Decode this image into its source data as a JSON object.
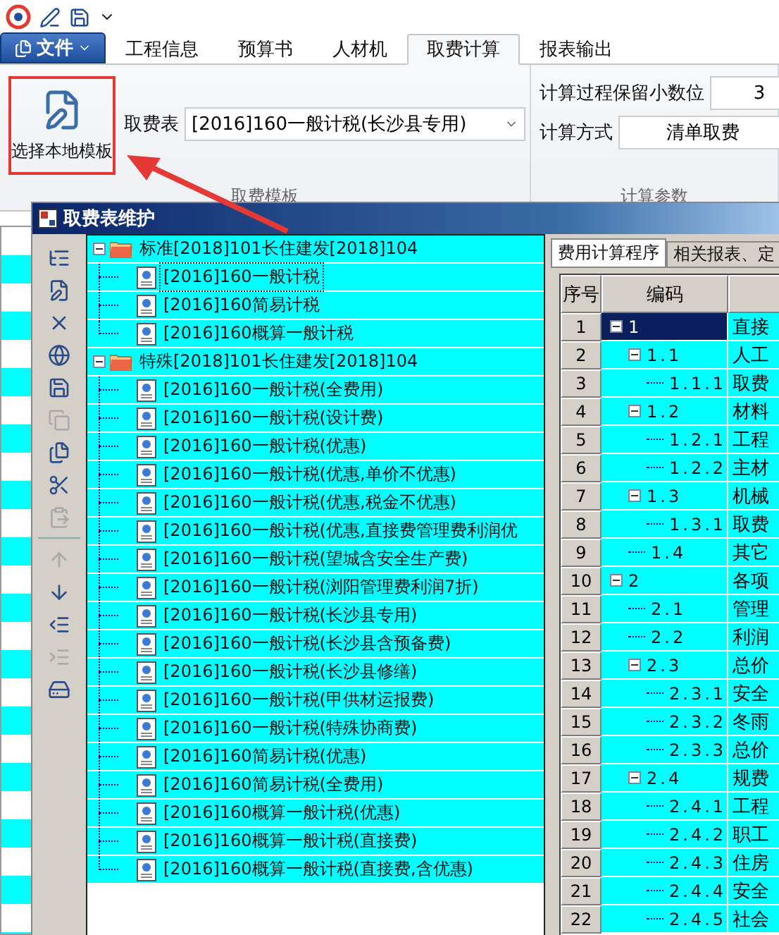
{
  "menu_button": {
    "label": "文件"
  },
  "tabs": [
    {
      "label": "工程信息",
      "selected": false
    },
    {
      "label": "预算书",
      "selected": false
    },
    {
      "label": "人材机",
      "selected": false
    },
    {
      "label": "取费计算",
      "selected": true
    },
    {
      "label": "报表输出",
      "selected": false
    }
  ],
  "ribbon": {
    "template_button": {
      "label": "选择本地模板",
      "highlighted": true
    },
    "fee_table": {
      "label": "取费表",
      "value": "[2016]160一般计税(长沙县专用)"
    },
    "group_1": "取费模板",
    "decimals": {
      "label": "计算过程保留小数位",
      "value": "3"
    },
    "method": {
      "label": "计算方式",
      "value": "清单取费"
    },
    "group_2": "计算参数"
  },
  "callout_arrow": true,
  "dialog": {
    "title": "取费表维护",
    "toolbar": [
      {
        "disabled": false
      },
      {
        "disabled": false
      },
      {
        "disabled": false
      },
      {
        "disabled": false
      },
      {
        "disabled": false
      },
      {
        "disabled": true
      },
      {
        "disabled": false
      },
      {
        "disabled": false
      },
      {
        "disabled": true
      },
      {
        "disabled": true
      },
      {
        "disabled": false
      },
      {
        "disabled": false
      },
      {
        "disabled": true
      },
      {
        "disabled": false
      }
    ],
    "tree": [
      {
        "label": "标准[2018]101长住建发[2018]104",
        "expanded": true,
        "children": [
          {
            "label": "[2016]160一般计税",
            "selected": true
          },
          {
            "label": "[2016]160简易计税",
            "selected": false
          },
          {
            "label": "[2016]160概算一般计税",
            "selected": false
          }
        ]
      },
      {
        "label": "特殊[2018]101长住建发[2018]104",
        "expanded": true,
        "children": [
          {
            "label": "[2016]160一般计税(全费用)",
            "selected": false
          },
          {
            "label": "[2016]160一般计税(设计费)",
            "selected": false
          },
          {
            "label": "[2016]160一般计税(优惠)",
            "selected": false
          },
          {
            "label": "[2016]160一般计税(优惠,单价不优惠)",
            "selected": false
          },
          {
            "label": "[2016]160一般计税(优惠,税金不优惠)",
            "selected": false
          },
          {
            "label": "[2016]160一般计税(优惠,直接费管理费利润优",
            "selected": false
          },
          {
            "label": "[2016]160一般计税(望城含安全生产费)",
            "selected": false
          },
          {
            "label": "[2016]160一般计税(浏阳管理费利润7折)",
            "selected": false
          },
          {
            "label": "[2016]160一般计税(长沙县专用)",
            "selected": false
          },
          {
            "label": "[2016]160一般计税(长沙县含预备费)",
            "selected": false
          },
          {
            "label": "[2016]160一般计税(长沙县修缮)",
            "selected": false
          },
          {
            "label": "[2016]160一般计税(甲供材运报费)",
            "selected": false
          },
          {
            "label": "[2016]160一般计税(特殊协商费)",
            "selected": false
          },
          {
            "label": "[2016]160简易计税(优惠)",
            "selected": false
          },
          {
            "label": "[2016]160简易计税(全费用)",
            "selected": false
          },
          {
            "label": "[2016]160概算一般计税(优惠)",
            "selected": false
          },
          {
            "label": "[2016]160概算一般计税(直接费)",
            "selected": false
          },
          {
            "label": "[2016]160概算一般计税(直接费,含优惠)",
            "selected": false
          }
        ]
      }
    ],
    "tabs": [
      {
        "label": "费用计算程序",
        "selected": true
      },
      {
        "label": "相关报表、定",
        "selected": false
      }
    ],
    "grid": {
      "columns": [
        "序号",
        "编码"
      ],
      "rows": [
        {
          "seq": "1",
          "code": "1",
          "name": "直接",
          "selected": true,
          "expanded": true,
          "children": [
            {
              "seq": "2",
              "code": "1.1",
              "name": "人工",
              "selected": false,
              "expanded": true,
              "children": [
                {
                  "seq": "3",
                  "code": "1.1.1",
                  "name": "取费",
                  "selected": false
                }
              ]
            },
            {
              "seq": "4",
              "code": "1.2",
              "name": "材料",
              "selected": false,
              "expanded": true,
              "children": [
                {
                  "seq": "5",
                  "code": "1.2.1",
                  "name": "工程",
                  "selected": false
                },
                {
                  "seq": "6",
                  "code": "1.2.2",
                  "name": "主材",
                  "selected": false
                }
              ]
            },
            {
              "seq": "7",
              "code": "1.3",
              "name": "机械",
              "selected": false,
              "expanded": true,
              "children": [
                {
                  "seq": "8",
                  "code": "1.3.1",
                  "name": "取费",
                  "selected": false
                }
              ]
            },
            {
              "seq": "9",
              "code": "1.4",
              "name": "其它",
              "selected": false
            }
          ]
        },
        {
          "seq": "10",
          "code": "2",
          "name": "各项",
          "selected": false,
          "expanded": true,
          "children": [
            {
              "seq": "11",
              "code": "2.1",
              "name": "管理",
              "selected": false
            },
            {
              "seq": "12",
              "code": "2.2",
              "name": "利润",
              "selected": false
            },
            {
              "seq": "13",
              "code": "2.3",
              "name": "总价",
              "selected": false,
              "expanded": true,
              "children": [
                {
                  "seq": "14",
                  "code": "2.3.1",
                  "name": "安全",
                  "selected": false
                },
                {
                  "seq": "15",
                  "code": "2.3.2",
                  "name": "冬雨",
                  "selected": false
                },
                {
                  "seq": "16",
                  "code": "2.3.3",
                  "name": "总价",
                  "selected": false
                }
              ]
            },
            {
              "seq": "17",
              "code": "2.4",
              "name": "规费",
              "selected": false,
              "expanded": true,
              "children": [
                {
                  "seq": "18",
                  "code": "2.4.1",
                  "name": "工程",
                  "selected": false
                },
                {
                  "seq": "19",
                  "code": "2.4.2",
                  "name": "职工",
                  "selected": false
                },
                {
                  "seq": "20",
                  "code": "2.4.3",
                  "name": "住房",
                  "selected": false
                },
                {
                  "seq": "21",
                  "code": "2.4.4",
                  "name": "安全",
                  "selected": false
                },
                {
                  "seq": "22",
                  "code": "2.4.5",
                  "name": "社会",
                  "selected": false
                }
              ]
            }
          ]
        }
      ]
    }
  }
}
